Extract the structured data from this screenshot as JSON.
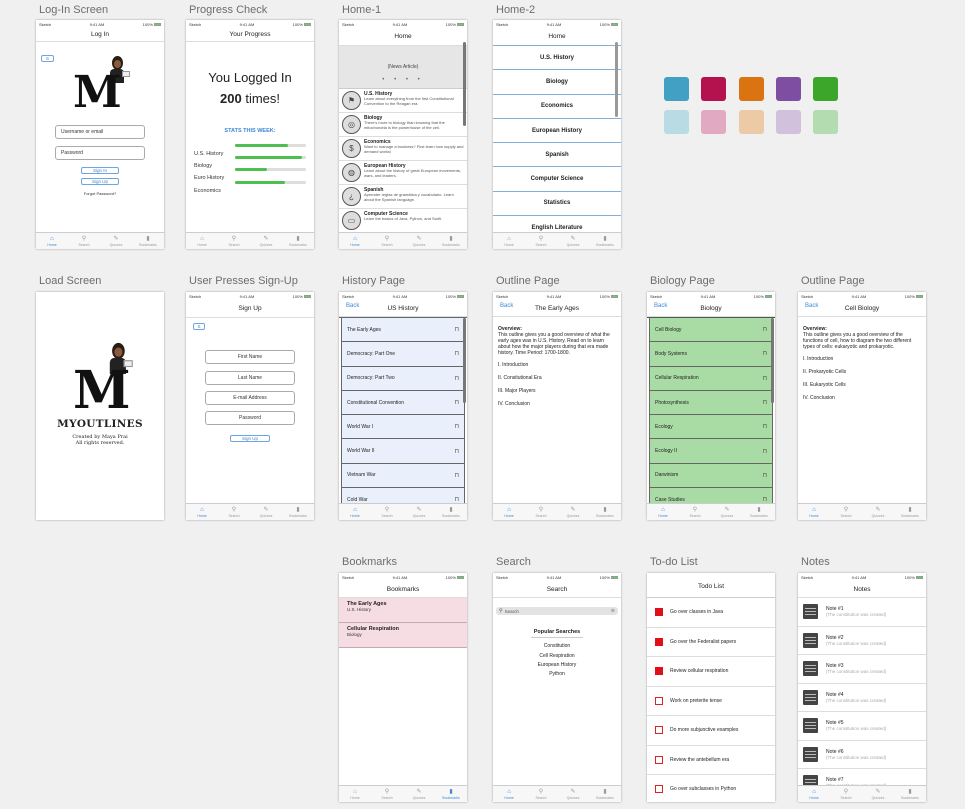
{
  "colors": {
    "swatches": [
      "#42a0c4",
      "#b3124e",
      "#d97411",
      "#7e4ea2",
      "#3ca62b",
      "#b9dbe3",
      "#e1a9c2",
      "#eccaa6",
      "#d1c1dc",
      "#b3dcb0"
    ],
    "accent": "#3d87d6",
    "biology_green": "#a9dba4",
    "history_blue": "#e9f0fb",
    "bookmark_pink": "#f6dde4",
    "todo_red": "#e0101b",
    "progress_green": "#4cbf50"
  },
  "status_bar": {
    "carrier": "Sketch",
    "time": "9:41 AM",
    "battery": "100%"
  },
  "tab_bar": {
    "home": "Home",
    "search": "Search",
    "quizzes": "Quizzes",
    "bookmarks": "Bookmarks"
  },
  "icons": {
    "home": "home-icon",
    "search": "search-icon",
    "quizzes": "quiz-icon",
    "bookmarks": "bookmark-icon"
  },
  "screens": {
    "login": {
      "label": "Log-In Screen",
      "title": "Log In",
      "badge": "S",
      "logo": "M",
      "username_placeholder": "Username or email",
      "password_placeholder": "Password",
      "sign_in": "Sign In",
      "sign_up": "Sign Up",
      "forgot": "Forgot Password?"
    },
    "progress": {
      "label": "Progress Check",
      "title": "Your Progress",
      "line1": "You Logged In",
      "count": "200",
      "line2": "times!",
      "stats_heading": "STATS THIS WEEK:",
      "stats": [
        {
          "name": "U.S. History",
          "value": 0.75
        },
        {
          "name": "Biology",
          "value": 0.95
        },
        {
          "name": "Euro History",
          "value": 0.45
        },
        {
          "name": "Economics",
          "value": 0.7
        }
      ]
    },
    "home1": {
      "label": "Home-1",
      "title": "Home",
      "news": "(News Article)",
      "items": [
        {
          "title": "U.S. History",
          "desc": "Learn about everything from the first Constitutional Convention to the Reagan era."
        },
        {
          "title": "Biology",
          "desc": "There's more to biology than knowing that the mitochondria is the powerhouse of the cell."
        },
        {
          "title": "Economics",
          "desc": "Want to manage a business? First learn how supply and demand works!"
        },
        {
          "title": "European History",
          "desc": "Learn about the history of great European movements, wars, and leaders."
        },
        {
          "title": "Spanish",
          "desc": "Aprender reglas de gramática y vocabulario. Learn about the Spanish language."
        },
        {
          "title": "Computer Science",
          "desc": "Learn the basics of Java, Python, and Swift."
        }
      ]
    },
    "home2": {
      "label": "Home-2",
      "title": "Home",
      "items": [
        "U.S. History",
        "Biology",
        "Economics",
        "European History",
        "Spanish",
        "Computer Science",
        "Statistics",
        "English Literature"
      ]
    },
    "load": {
      "label": "Load Screen",
      "logo": "M",
      "app_name": "MYOUTLINES",
      "credit1": "Created by Maya Prai",
      "credit2": "All rights reserved."
    },
    "signup": {
      "label": "User Presses Sign-Up",
      "title": "Sign Up",
      "badge": "S",
      "first": "First Name",
      "last": "Last Name",
      "email": "E-mail Address",
      "password": "Password",
      "button": "Sign Up"
    },
    "history": {
      "label": "History Page",
      "back": "Back",
      "title": "US History",
      "items": [
        "The Early Ages",
        "Democracy: Part One",
        "Democracy: Part Two",
        "Constitutional Convention",
        "World War I",
        "World War II",
        "Vietnam War",
        "Cold War"
      ]
    },
    "outline1": {
      "label": "Outline Page",
      "back": "Back",
      "title": "The Early Ages",
      "heading": "Overview:",
      "body": "This outline gives you a good overview of what the early ages was in U.S. History. Read on to learn about how the major players during that era made history. Time Period: 1700-1800.",
      "sections": [
        "I. Introduction",
        "II. Consitutional Era",
        "III. Major Players",
        "IV. Conclusion"
      ]
    },
    "biology": {
      "label": "Biology Page",
      "back": "Back",
      "title": "Biology",
      "items": [
        "Cell Biology",
        "Body Systems",
        "Cellular Respiration",
        "Photosynthesis",
        "Ecology",
        "Ecology II",
        "Darwinism",
        "Case Studies"
      ]
    },
    "outline2": {
      "label": "Outline Page",
      "back": "Back",
      "title": "Cell Biology",
      "heading": "Overview:",
      "body": "This outline gives you a good overview of the functions of cell, how to diagram the two different types of cells: eukaryotic and prokaryotic.",
      "sections": [
        "I. Introduction",
        "II. Prokaryotic Cells",
        "III. Eukaryotic Cells",
        "IV. Conclusion"
      ]
    },
    "bookmarks": {
      "label": "Bookmarks",
      "title": "Bookmarks",
      "items": [
        {
          "title": "The Early Ages",
          "subject": "U.S. History"
        },
        {
          "title": "Cellular Respiration",
          "subject": "Biology"
        }
      ]
    },
    "search": {
      "label": "Search",
      "title": "Search",
      "placeholder": "Search",
      "popular_heading": "Popular Searches",
      "popular": [
        "Constitution",
        "Cell Respiration",
        "European History",
        "Python"
      ]
    },
    "todo": {
      "label": "To-do List",
      "title": "Todo List",
      "items": [
        {
          "text": "Go over classes in Java",
          "done": true
        },
        {
          "text": "Go over the Federalist papers",
          "done": true
        },
        {
          "text": "Review cellular respiration",
          "done": true
        },
        {
          "text": "Work on preterite tense",
          "done": false
        },
        {
          "text": "Do more subjunctive examples",
          "done": false
        },
        {
          "text": "Review the antebellum era",
          "done": false
        },
        {
          "text": "Go over subclasses in Python",
          "done": false
        }
      ]
    },
    "notes": {
      "label": "Notes",
      "title": "Notes",
      "preview": "(The constitution was created)",
      "items": [
        "Note #1",
        "Note #2",
        "Note #3",
        "Note #4",
        "Note #5",
        "Note #6",
        "Note #7"
      ]
    }
  }
}
